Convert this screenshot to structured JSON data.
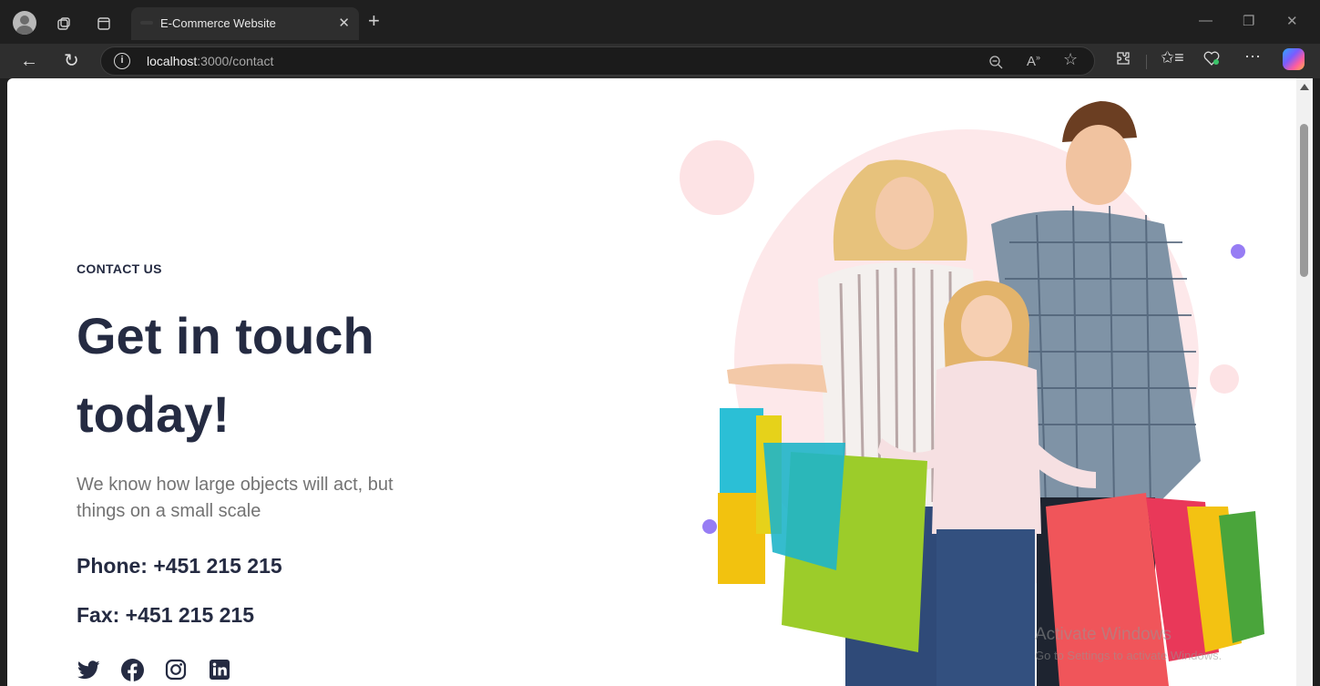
{
  "browser": {
    "tab_title": "E-Commerce Website",
    "url_host": "localhost",
    "url_rest": ":3000/contact",
    "icons": [
      "profile-icon",
      "workspaces-icon",
      "tab-actions-icon",
      "close-tab-icon",
      "new-tab-icon",
      "minimize-icon",
      "restore-icon",
      "window-close-icon",
      "back-icon",
      "refresh-icon",
      "site-info-icon",
      "zoom-out-icon",
      "read-aloud-icon",
      "favorite-icon",
      "extensions-icon",
      "favorites-icon",
      "browser-essentials-icon",
      "more-icon",
      "copilot-icon"
    ]
  },
  "contact": {
    "eyebrow": "CONTACT US",
    "headline": "Get in touch today!",
    "lead": "We know how large objects will act, but things on a small scale",
    "phone": "Phone: +451 215 215",
    "fax": "Fax: +451 215 215",
    "socials": [
      "twitter-icon",
      "facebook-icon",
      "instagram-icon",
      "linkedin-icon"
    ]
  },
  "watermark": {
    "line1": "Activate Windows",
    "line2": "Go to Settings to activate Windows."
  },
  "colors": {
    "heading": "#252b42",
    "body_text": "#737373",
    "accent_purple": "#977df4",
    "blush": "#fde8ea"
  }
}
